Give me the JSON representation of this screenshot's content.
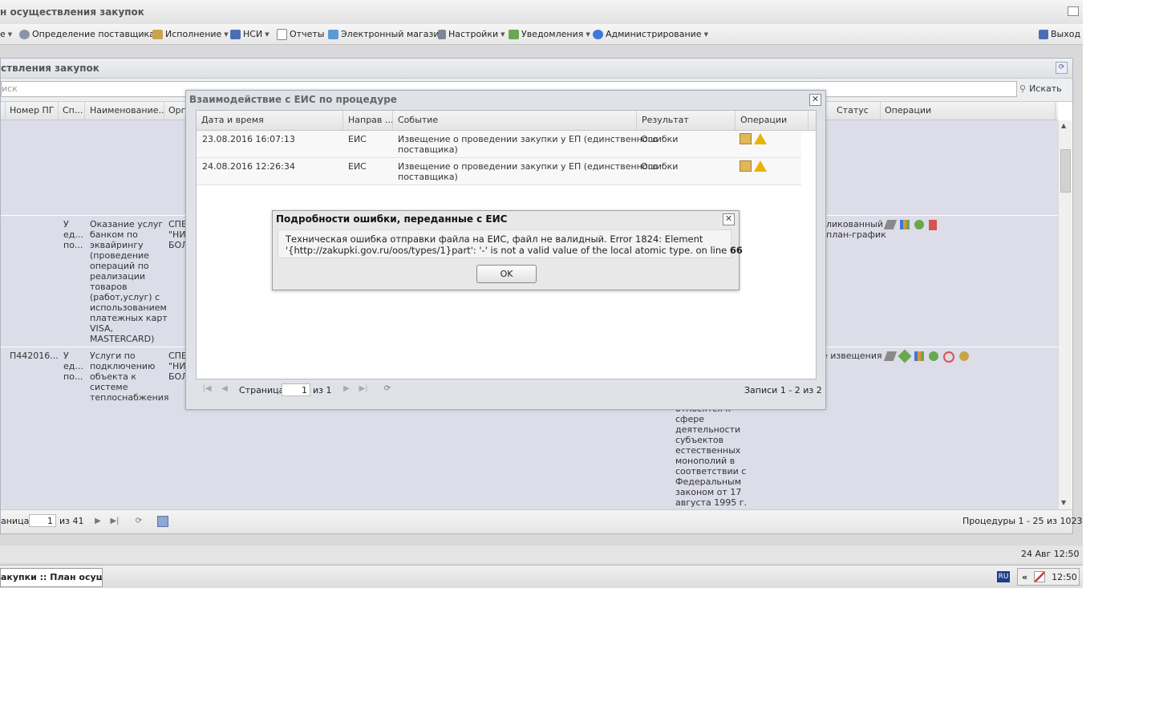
{
  "window": {
    "title": "н осуществления закупок"
  },
  "menu": [
    {
      "label": "е",
      "icon": "folder-icon"
    },
    {
      "label": "Определение поставщика",
      "icon": "gears-icon"
    },
    {
      "label": "Исполнение",
      "icon": "box-icon"
    },
    {
      "label": "НСИ",
      "icon": "book-icon"
    },
    {
      "label": "Отчеты",
      "icon": "report-icon"
    },
    {
      "label": "Электронный магазин",
      "icon": "cart-icon"
    },
    {
      "label": "Настройки",
      "icon": "wrench-icon"
    },
    {
      "label": "Уведомления",
      "icon": "calendar-icon"
    },
    {
      "label": "Администрирование",
      "icon": "user-icon"
    }
  ],
  "exit_label": "Выход",
  "panel": {
    "title": "ствления закупок",
    "search_placeholder": "иск",
    "search_button": "Искать",
    "columns": [
      "Номер ПГ",
      "Сп...",
      "Наименование...",
      "Орга",
      "Статус",
      "Операции"
    ],
    "rows": [
      {
        "num": "",
        "sp": "",
        "name": "",
        "org": "",
        "status": "",
        "mid": ""
      },
      {
        "num": "",
        "sp": "У\nед...\nпо...",
        "name": "Оказание услуг\nбанком по\nэквайрингу\n(проведение\nопераций по\nреализации\nтоваров\n(работ,услуг) с\nиспользованием\nплатежных карт\nVISA,\nMASTERCARD)",
        "org": "СПБ\n\"НИ\nБОЛ",
        "status": "ликованный\nплан-график",
        "mid": ""
      },
      {
        "num": "П442016...",
        "sp": "У\nед...\nпо...",
        "name": "Услуги по\nподключению\nобъекта к\nсистеме\nтеплоснабжения",
        "org": "СПБ\n\"НИ\nБОЛ",
        "status": "е извещения",
        "mid": "относятся к\nсфере\nдеятельности\nсубъектов\nестественных\nмонополий в\nсоответствии с\nФедеральным\nзаконом от 17\nавгуста 1995 г."
      }
    ],
    "pager": {
      "page_label": "аница",
      "page_value": "1",
      "of": "из 41",
      "summary": "Процедуры 1 - 25 из 1023"
    }
  },
  "status_time": "24 Авг 12:50",
  "taskbar": {
    "task": "акупки :: План осущ...",
    "lang": "RU",
    "tray_arrows": "«",
    "clock": "12:50"
  },
  "dialog1": {
    "title": "Взаимодействие с ЕИС по процедуре",
    "columns": [
      "Дата и время",
      "Направ ...",
      "Событие",
      "Результат",
      "Операции"
    ],
    "rows": [
      {
        "date": "23.08.2016 16:07:13",
        "dir": "ЕИС",
        "event": "Извещение о проведении закупки у ЕП (единственного\nпоставщика)",
        "result": "Ошибки"
      },
      {
        "date": "24.08.2016 12:26:34",
        "dir": "ЕИС",
        "event": "Извещение о проведении закупки у ЕП (единственного\nпоставщика)",
        "result": "Ошибки"
      }
    ],
    "pager": {
      "page_label": "Страница",
      "page_value": "1",
      "of": "из 1",
      "summary": "Записи 1 - 2 из 2"
    }
  },
  "dialog2": {
    "title": "Подробности ошибки, переданные с ЕИС",
    "message_line1": "Техническая ошибка отправки файла на ЕИС, файл не валидный. Error 1824: Element",
    "message_line2": "'{http://zakupki.gov.ru/oos/types/1}part': '-' is not a valid value of the local atomic type. on line",
    "line_number": "66",
    "ok": "OK"
  }
}
